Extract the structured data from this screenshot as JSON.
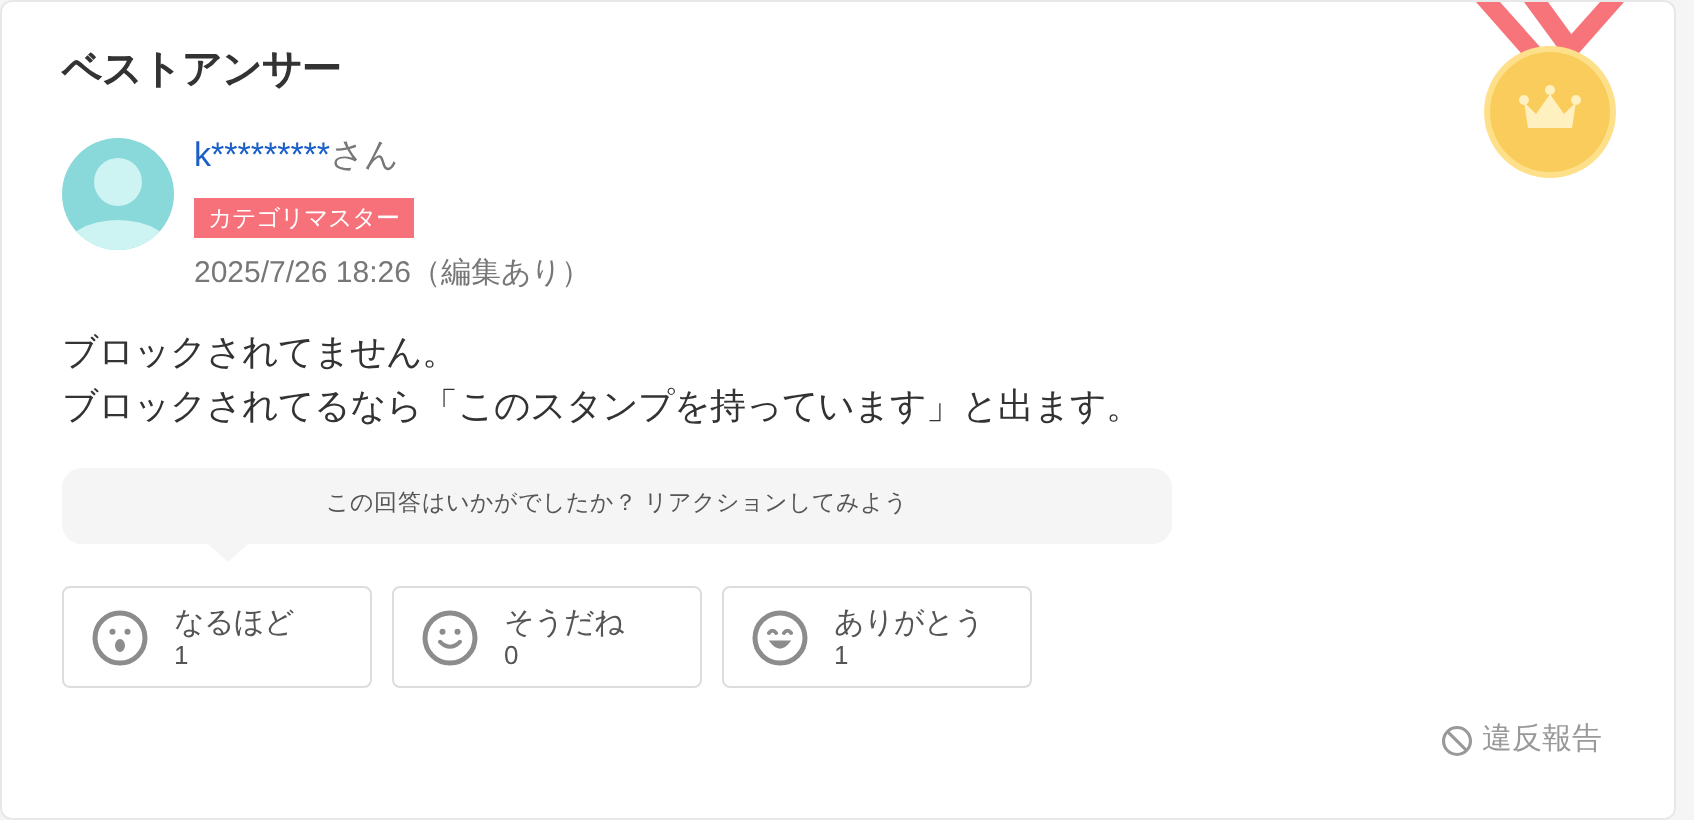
{
  "title": "ベストアンサー",
  "author": {
    "name": "k*********",
    "honorific": "さん",
    "badge": "カテゴリマスター",
    "date": "2025/7/26 18:26（編集あり）"
  },
  "body": [
    "ブロックされてません。",
    "ブロックされてるなら「このスタンプを持っています」と出ます。"
  ],
  "reaction_prompt": "この回答はいかがでしたか？ リアクションしてみよう",
  "reactions": [
    {
      "kind": "surprised",
      "label": "なるほど",
      "count": "1"
    },
    {
      "kind": "smile",
      "label": "そうだね",
      "count": "0"
    },
    {
      "kind": "laugh",
      "label": "ありがとう",
      "count": "1"
    }
  ],
  "report_link": "違反報告"
}
